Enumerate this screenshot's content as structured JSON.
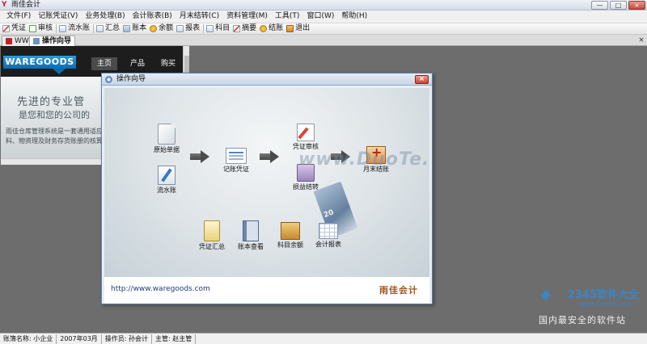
{
  "window": {
    "title": "雨佳会计",
    "app_icon": "app-logo-icon",
    "buttons": {
      "minimize": "—",
      "maximize": "□",
      "close": "×"
    }
  },
  "menu": [
    "文件(F)",
    "记账凭证(V)",
    "业务处理(B)",
    "会计账表(B)",
    "月末结转(C)",
    "资料管理(M)",
    "工具(T)",
    "窗口(W)",
    "帮助(H)"
  ],
  "toolbar": [
    {
      "label": "凭证",
      "icon": "voucher-icon"
    },
    {
      "label": "审核",
      "icon": "audit-icon"
    },
    {
      "label": "流水账",
      "icon": "journal-icon"
    },
    {
      "label": "汇总",
      "icon": "summary-icon"
    },
    {
      "label": "账本",
      "icon": "ledger-icon"
    },
    {
      "label": "余额",
      "icon": "balance-icon"
    },
    {
      "label": "报表",
      "icon": "report-icon"
    },
    {
      "label": "科目",
      "icon": "subject-icon"
    },
    {
      "label": "摘要",
      "icon": "abstract-icon"
    },
    {
      "label": "结账",
      "icon": "close-account-icon"
    },
    {
      "label": "退出",
      "icon": "exit-icon"
    }
  ],
  "tabs": [
    {
      "label": "WWW"
    },
    {
      "label": "操作向导"
    }
  ],
  "web": {
    "logo": "WAREGOODS",
    "nav": [
      "主页",
      "产品",
      "购买"
    ],
    "headline": "先进的专业管",
    "subheadline": "是您和您的公司的",
    "paragraph": "雨佳仓库管理系统是一套通用适应用于各类企事业单位的材料、物资理及财务存货账册的核算管理。"
  },
  "dialog": {
    "title": "操作向导",
    "close": "×",
    "nodes": {
      "original_doc": "原始单据",
      "journal": "流水账",
      "record_voucher": "记账凭证",
      "voucher_review": "凭证审核",
      "profit_loss": "损益结转",
      "month_close": "月末结账",
      "voucher_summary": "凭证汇总",
      "ledger_view": "账本查看",
      "subject_balance": "科目余额",
      "accounting_report": "会计报表"
    },
    "note_value": "20",
    "watermark": "www.DuoTe.com",
    "footer_url": "http://www.waregoods.com",
    "footer_brand": "雨佳会计"
  },
  "corner_brand": {
    "name": "2345软件大全",
    "url": "www.DuoTe.com",
    "tagline": "国内最安全的软件站"
  },
  "status": [
    "账簿名称: 小企业",
    "2007年03月",
    "操作员: 孙会计",
    "主管: 赵主管"
  ]
}
